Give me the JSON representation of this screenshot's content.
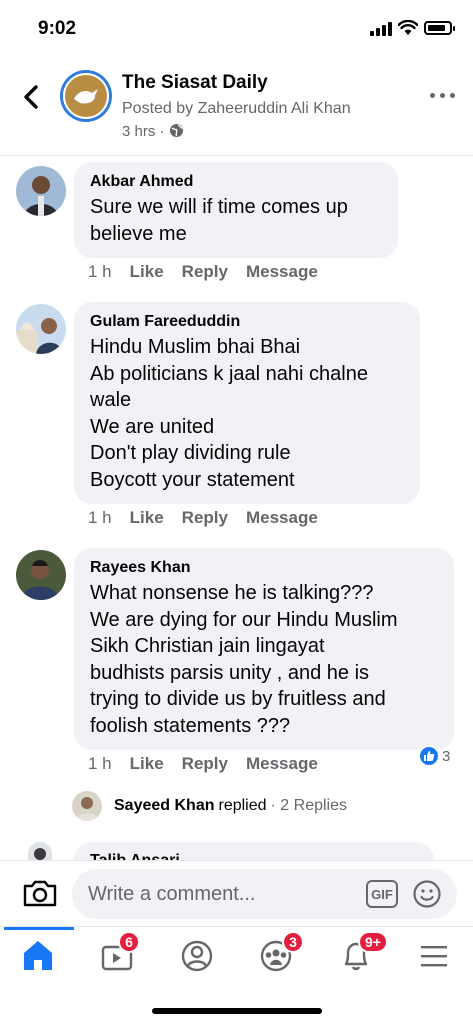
{
  "status_bar": {
    "time": "9:02"
  },
  "header": {
    "title": "The Siasat Daily",
    "subtitle": "Posted by Zaheeruddin Ali Khan",
    "time": "3 hrs ·"
  },
  "comments": [
    {
      "name": "Akbar Ahmed",
      "lines": [
        "Sure we will if time comes up",
        "believe me"
      ],
      "time": "1 h",
      "like": "Like",
      "reply": "Reply",
      "message": "Message"
    },
    {
      "name": "Gulam Fareeduddin",
      "lines": [
        "Hindu Muslim bhai Bhai",
        "Ab politicians k jaal nahi chalne",
        "wale",
        "We are united",
        "Don't play dividing rule",
        "Boycott your statement"
      ],
      "time": "1 h",
      "like": "Like",
      "reply": "Reply",
      "message": "Message"
    },
    {
      "name": "Rayees Khan",
      "lines": [
        "What nonsense he is talking???",
        "We are dying for our Hindu Muslim",
        "Sikh Christian jain lingayat",
        "budhists parsis unity , and he is",
        "trying to divide us by fruitless and",
        "foolish statements ???"
      ],
      "time": "1 h",
      "like": "Like",
      "reply": "Reply",
      "message": "Message",
      "reaction_count": "3"
    }
  ],
  "reply_summary": {
    "name": "Sayeed Khan",
    "verb": "replied",
    "count": "· 2 Replies"
  },
  "partial_comment": {
    "name": "Talib Ansari"
  },
  "composer": {
    "placeholder": "Write a comment...",
    "gif_label": "GIF"
  },
  "tabbar": {
    "video_badge": "6",
    "groups_badge": "3",
    "notifications_badge": "9+"
  },
  "colors": {
    "accent": "#1877f2",
    "badge": "#e41e3f",
    "bubble": "#f0f2f5"
  },
  "icons": [
    "back-icon",
    "more-icon",
    "globe-icon",
    "camera-icon",
    "gif-icon",
    "emoji-icon",
    "home-icon",
    "video-icon",
    "profile-icon",
    "groups-icon",
    "bell-icon",
    "menu-icon",
    "like-icon"
  ]
}
